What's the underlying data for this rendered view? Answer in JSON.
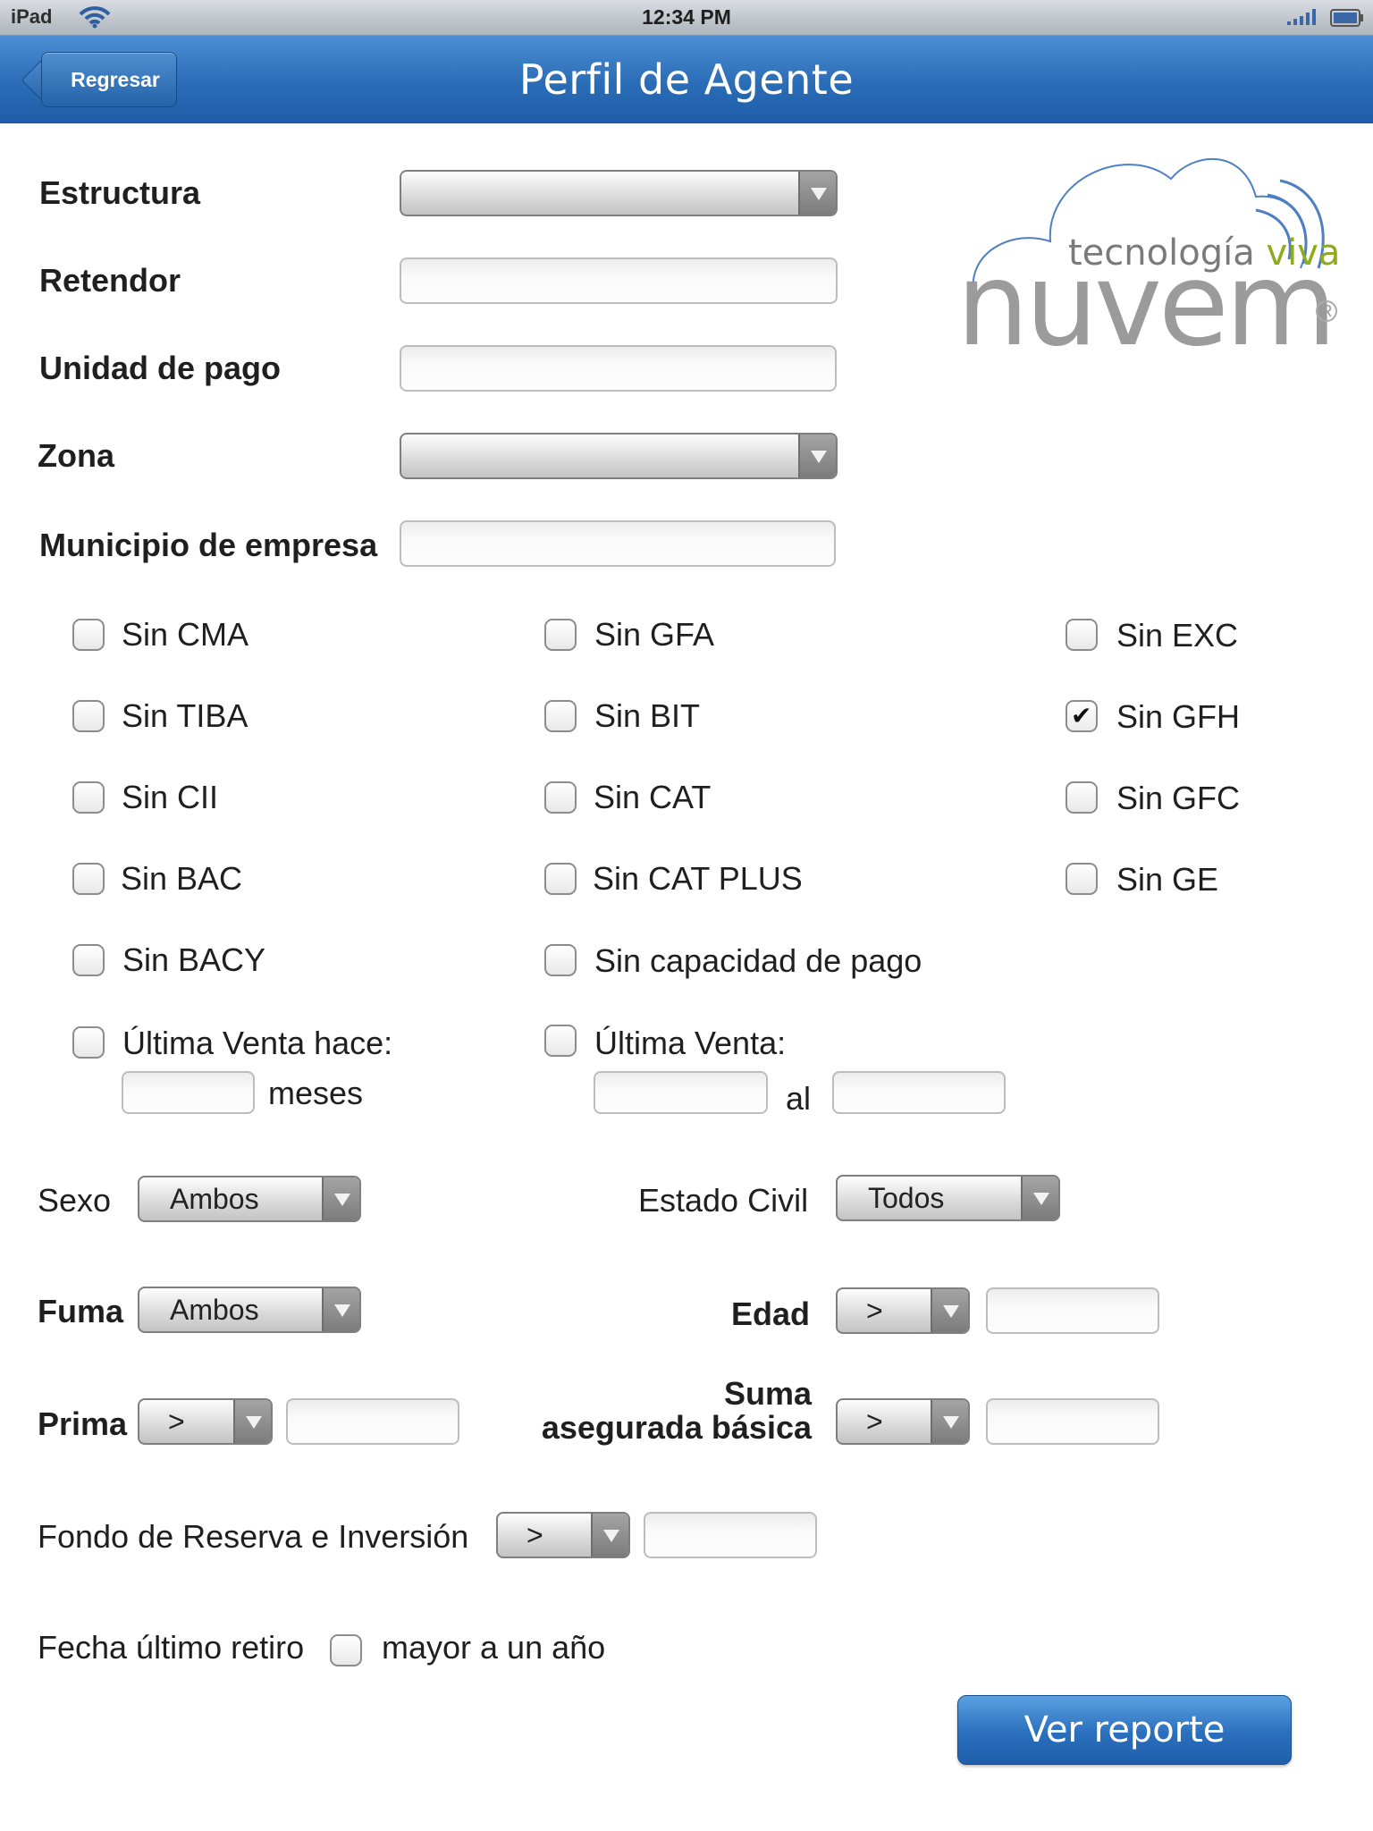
{
  "status_bar": {
    "device": "iPad",
    "time": "12:34 PM"
  },
  "nav": {
    "back_label": "Regresar",
    "title": "Perfil de Agente"
  },
  "logo": {
    "tagline_1": "tecnología",
    "tagline_2": "viva",
    "brand": "nuvem",
    "registered": "R"
  },
  "form": {
    "estructura_label": "Estructura",
    "retendor_label": "Retendor",
    "unidad_label": "Unidad de pago",
    "zona_label": "Zona",
    "municipio_label": "Municipio de empresa"
  },
  "checkboxes": {
    "sin_cma": "Sin CMA",
    "sin_tiba": "Sin TIBA",
    "sin_cii": "Sin CII",
    "sin_bac": "Sin BAC",
    "sin_bacy": "Sin BACY",
    "sin_gfa": "Sin GFA",
    "sin_bit": "Sin BIT",
    "sin_cat": "Sin CAT",
    "sin_cat_plus": "Sin CAT PLUS",
    "sin_capacidad": "Sin capacidad de pago",
    "sin_exc": "Sin EXC",
    "sin_gfh": "Sin GFH",
    "sin_gfc": "Sin GFC",
    "sin_ge": "Sin GE"
  },
  "ultima_venta_hace": {
    "label": "Última Venta hace:",
    "unit": "meses"
  },
  "ultima_venta": {
    "label": "Última Venta:",
    "separator": "al"
  },
  "sexo": {
    "label": "Sexo",
    "value": "Ambos"
  },
  "estado_civil": {
    "label": "Estado Civil",
    "value": "Todos"
  },
  "fuma": {
    "label": "Fuma",
    "value": "Ambos"
  },
  "edad": {
    "label": "Edad",
    "operator": ">"
  },
  "prima": {
    "label": "Prima",
    "operator": ">"
  },
  "suma": {
    "label_line1": "Suma",
    "label_line2": "asegurada básica",
    "operator": ">"
  },
  "fondo": {
    "label": "Fondo de Reserva e Inversión",
    "operator": ">"
  },
  "fecha_retiro": {
    "label": "Fecha último retiro",
    "option": "mayor a un año"
  },
  "actions": {
    "report_label": "Ver reporte"
  },
  "colors": {
    "nav_blue": "#2a6cb6",
    "brand_gray": "#9b9b9b",
    "brand_green": "#8cab1e"
  }
}
